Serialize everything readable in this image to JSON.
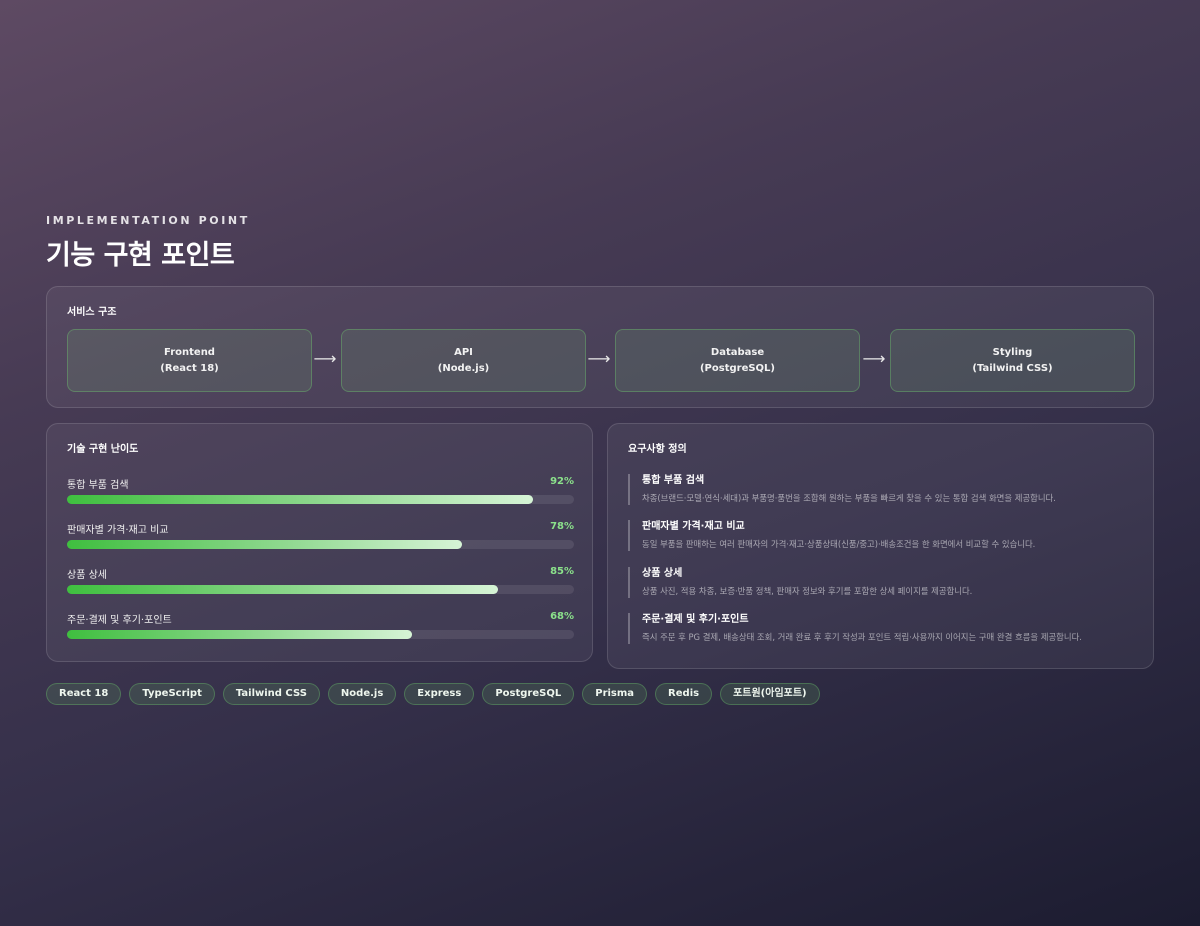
{
  "header": {
    "eyebrow": "IMPLEMENTATION POINT",
    "title": "기능 구현 포인트"
  },
  "architecture": {
    "title": "서비스 구조",
    "arrow": "⟶",
    "nodes": [
      {
        "name": "Frontend",
        "detail": "(React 18)"
      },
      {
        "name": "API",
        "detail": "(Node.js)"
      },
      {
        "name": "Database",
        "detail": "(PostgreSQL)"
      },
      {
        "name": "Styling",
        "detail": "(Tailwind CSS)"
      }
    ]
  },
  "difficulty": {
    "title": "기술 구현 난이도",
    "items": [
      {
        "label": "통합 부품 검색",
        "percent_text": "92%",
        "value": 92
      },
      {
        "label": "판매자별 가격·재고 비교",
        "percent_text": "78%",
        "value": 78
      },
      {
        "label": "상품 상세",
        "percent_text": "85%",
        "value": 85
      },
      {
        "label": "주문·결제 및 후기·포인트",
        "percent_text": "68%",
        "value": 68
      }
    ]
  },
  "requirements": {
    "title": "요구사항 정의",
    "items": [
      {
        "title": "통합 부품 검색",
        "desc": "차종(브랜드·모델·연식·세대)과 부품명·품번을 조합해 원하는 부품을 빠르게 찾을 수 있는 통합 검색 화면을 제공합니다."
      },
      {
        "title": "판매자별 가격·재고 비교",
        "desc": "동일 부품을 판매하는 여러 판매자의 가격·재고·상품상태(신품/중고)·배송조건을 한 화면에서 비교할 수 있습니다."
      },
      {
        "title": "상품 상세",
        "desc": "상품 사진, 적용 차종, 보증·반품 정책, 판매자 정보와 후기를 포함한 상세 페이지를 제공합니다."
      },
      {
        "title": "주문·결제 및 후기·포인트",
        "desc": "즉시 주문 후 PG 결제, 배송상태 조회, 거래 완료 후 후기 작성과 포인트 적립·사용까지 이어지는 구매 완결 흐름을 제공합니다."
      }
    ]
  },
  "tags": [
    "React 18",
    "TypeScript",
    "Tailwind CSS",
    "Node.js",
    "Express",
    "PostgreSQL",
    "Prisma",
    "Redis",
    "포트원(아임포트)"
  ]
}
